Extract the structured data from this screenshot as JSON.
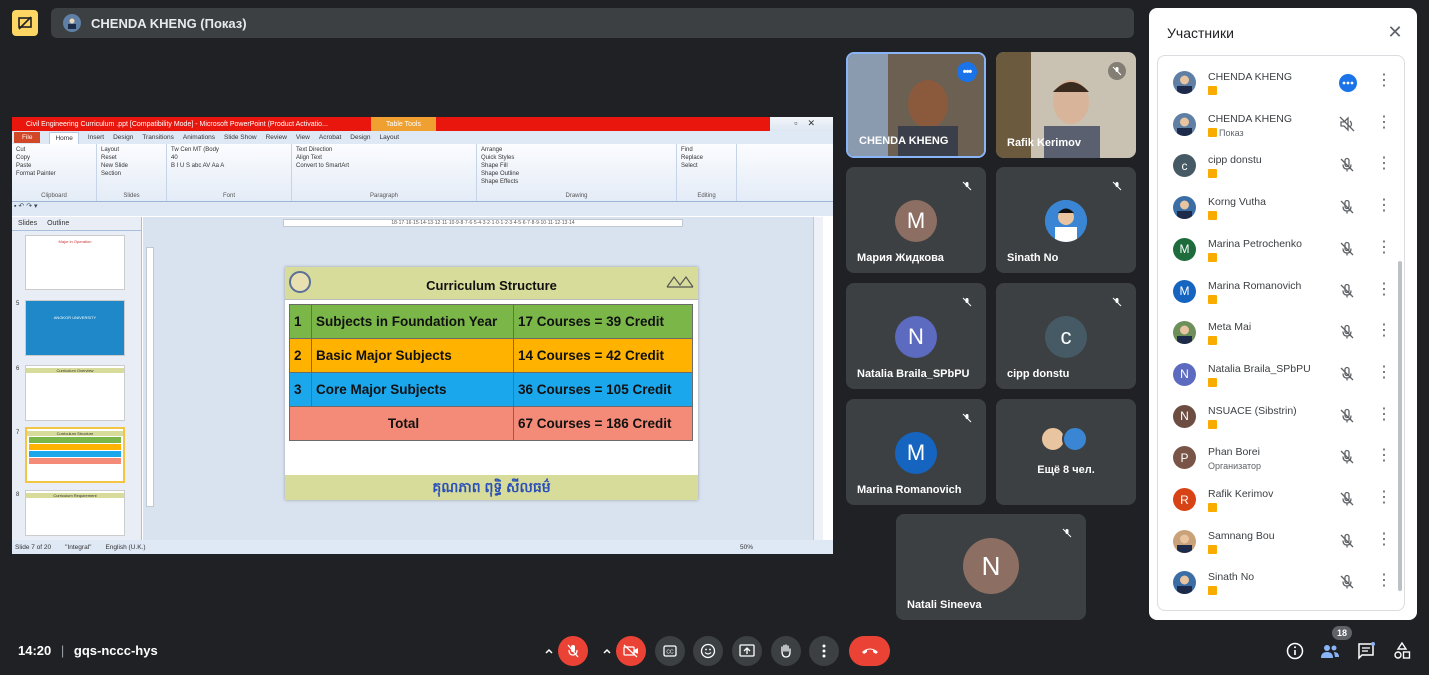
{
  "top": {
    "presenter_name": "CHENDA KHENG (Показ)"
  },
  "ppt": {
    "window_title": "Civil Engineering Curriculum .ppt [Compatibility Mode] - Microsoft PowerPoint (Product Activatio...",
    "table_tools": "Table Tools",
    "tabs": [
      "File",
      "Home",
      "Insert",
      "Design",
      "Transitions",
      "Animations",
      "Slide Show",
      "Review",
      "View",
      "Acrobat",
      "Design",
      "Layout"
    ],
    "ribbon_groups": [
      {
        "label": "Clipboard",
        "lines": [
          "Cut",
          "Copy",
          "Paste",
          "Format Painter"
        ]
      },
      {
        "label": "Slides",
        "lines": [
          "Layout",
          "Reset",
          "New Slide",
          "Section"
        ]
      },
      {
        "label": "Font",
        "lines": [
          "Tw Cen MT (Body",
          "40",
          "B I U S abc AV Aa A"
        ]
      },
      {
        "label": "Paragraph",
        "lines": [
          "Text Direction",
          "Align Text",
          "Convert to SmartArt"
        ]
      },
      {
        "label": "Drawing",
        "lines": [
          "Arrange",
          "Quick Styles",
          "Shape Fill",
          "Shape Outline",
          "Shape Effects"
        ]
      },
      {
        "label": "Editing",
        "lines": [
          "Find",
          "Replace",
          "Select"
        ]
      }
    ],
    "panel_tabs": [
      "Slides",
      "Outline"
    ],
    "ruler_text": "18·17·16·15·14·13·12·11·10·9·8·7·6·5·4·3·2·1·0·1·2·3·4·5·6·7·8·9·10·11·12·13·14",
    "thumbs": [
      {
        "num": "",
        "text": "Major in Operation"
      },
      {
        "num": "5",
        "text": "ANGKOR UNIVERSITY"
      },
      {
        "num": "6",
        "text": "Curriculum Overview"
      },
      {
        "num": "7",
        "text": "Curriculum Structure"
      },
      {
        "num": "8",
        "text": "Curriculum Requirement"
      }
    ],
    "status": {
      "slide": "Slide 7 of 20",
      "theme": "\"Integral\"",
      "lang": "English (U.K.)",
      "zoom": "50%"
    }
  },
  "slide": {
    "title": "Curriculum Structure",
    "rows": [
      {
        "num": "1",
        "subject": "Subjects in Foundation Year",
        "credit": "17 Courses = 39 Credit",
        "color": "#7ab648"
      },
      {
        "num": "2",
        "subject": "Basic Major Subjects",
        "credit": "14 Courses = 42 Credit",
        "color": "#ffb300"
      },
      {
        "num": "3",
        "subject": "Core Major Subjects",
        "credit": "36 Courses = 105 Credit",
        "color": "#1aa7ec"
      }
    ],
    "total_label": "Total",
    "total_value": "67 Courses = 186 Credit",
    "total_color": "#f38b78",
    "footer": "គុណភាព ពុទ្ធិ សីលធម៌"
  },
  "tiles": [
    {
      "name": "CHENDA KHENG"
    },
    {
      "name": "Rafik Kerimov"
    },
    {
      "name": "Мария Жидкова",
      "initial": "M",
      "color": "#8d6e63"
    },
    {
      "name": "Sinath No"
    },
    {
      "name": "Natalia Braila_SPbPU",
      "initial": "N",
      "color": "#5c6bc0"
    },
    {
      "name": "cipp donstu",
      "initial": "c",
      "color": "#455a64"
    },
    {
      "name": "Marina Romanovich",
      "initial": "M",
      "color": "#1565c0"
    },
    {
      "name": "Ещё 8 чел."
    },
    {
      "name": "Natali Sineeva",
      "initial": "N",
      "color": "#8d6e63"
    }
  ],
  "panel": {
    "title": "Участники",
    "participants": [
      {
        "name": "CHENDA KHENG",
        "sub": "",
        "initial": "",
        "color": "#5f7fa5",
        "status": "speaking"
      },
      {
        "name": "CHENDA KHENG",
        "sub": "Показ",
        "initial": "",
        "color": "#5f7fa5",
        "status": "presenting"
      },
      {
        "name": "cipp donstu",
        "sub": "",
        "initial": "c",
        "color": "#455a64",
        "status": "muted"
      },
      {
        "name": "Korng Vutha",
        "sub": "",
        "initial": "",
        "color": "#3a6ea5",
        "status": "muted"
      },
      {
        "name": "Marina Petrochenko",
        "sub": "",
        "initial": "M",
        "color": "#1e6b3c",
        "status": "muted"
      },
      {
        "name": "Marina Romanovich",
        "sub": "",
        "initial": "M",
        "color": "#1565c0",
        "status": "muted"
      },
      {
        "name": "Meta Mai",
        "sub": "",
        "initial": "",
        "color": "#6d8f5a",
        "status": "muted"
      },
      {
        "name": "Natalia Braila_SPbPU",
        "sub": "",
        "initial": "N",
        "color": "#5c6bc0",
        "status": "muted"
      },
      {
        "name": "NSUACE (Sibstrin)",
        "sub": "",
        "initial": "N",
        "color": "#6d4c41",
        "status": "muted"
      },
      {
        "name": "Phan Borei",
        "sub": "Организатор",
        "initial": "P",
        "color": "#795548",
        "status": "muted"
      },
      {
        "name": "Rafik Kerimov",
        "sub": "",
        "initial": "R",
        "color": "#d84315",
        "status": "muted"
      },
      {
        "name": "Samnang Bou",
        "sub": "",
        "initial": "",
        "color": "#c9a27a",
        "status": "muted"
      },
      {
        "name": "Sinath No",
        "sub": "",
        "initial": "",
        "color": "#3a6ea5",
        "status": "muted"
      }
    ]
  },
  "bottom": {
    "time": "14:20",
    "meeting_code": "gqs-nccc-hys",
    "participant_count": "18"
  }
}
